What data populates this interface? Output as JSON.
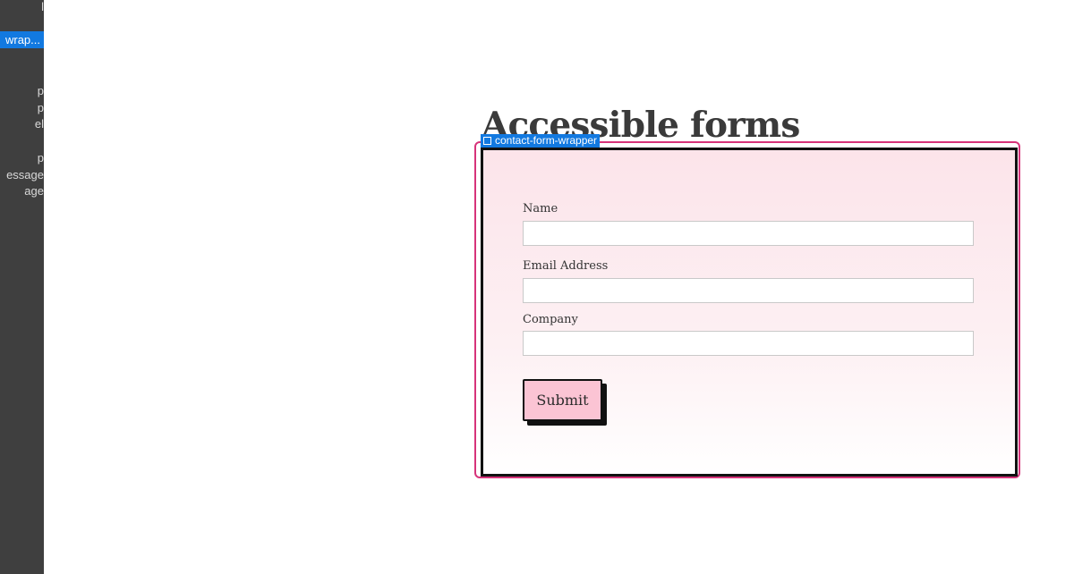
{
  "navigator": {
    "items": [
      {
        "label": "l",
        "selected": false
      },
      {
        "label": "wrap...",
        "selected": true
      },
      {
        "label": "p",
        "selected": false
      },
      {
        "label": "p",
        "selected": false
      },
      {
        "label": "el",
        "selected": false
      },
      {
        "label": "p",
        "selected": false
      },
      {
        "label": "essage",
        "selected": false
      },
      {
        "label": "age",
        "selected": false
      }
    ]
  },
  "page": {
    "title": "Accessible forms"
  },
  "selection": {
    "element_name": "contact-form-wrapper",
    "outline_color": "#d6337a",
    "tag_color": "#1279e0"
  },
  "form": {
    "fields": [
      {
        "label": "Name",
        "value": ""
      },
      {
        "label": "Email Address",
        "value": ""
      },
      {
        "label": "Company",
        "value": ""
      }
    ],
    "submit_label": "Submit",
    "background_color": "#fce4ea",
    "button_color": "#fbc4d4"
  }
}
